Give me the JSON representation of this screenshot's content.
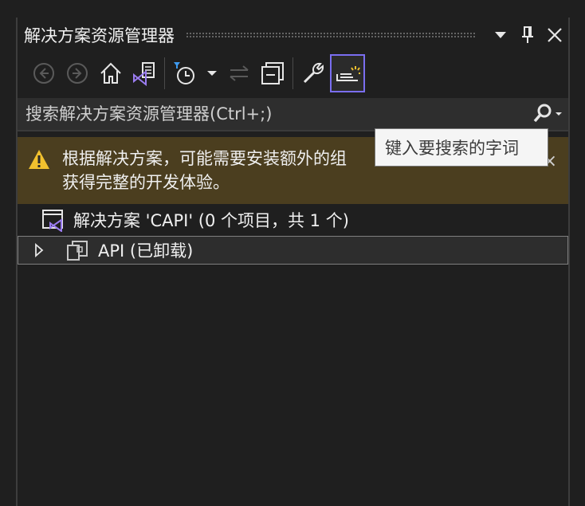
{
  "window": {
    "title": "解决方案资源管理器"
  },
  "search": {
    "placeholder": "搜索解决方案资源管理器(Ctrl+;)"
  },
  "infobar": {
    "line1": "根据解决方案，可能需要安装额外的组",
    "line2": "获得完整的开发体验。",
    "close_glyph": "×"
  },
  "tree": {
    "root_label": "解决方案 'CAPI' (0 个项目，共 1 个)",
    "project_label": "API (已卸载)"
  },
  "tooltip": {
    "text": "键入要搜索的字词"
  },
  "icons": {
    "dropdown": "chevron-down-icon",
    "pin": "pin-icon",
    "close": "close-icon",
    "back": "back-icon",
    "forward": "forward-icon",
    "home": "home-icon",
    "switch_views": "vs-switch-views-icon",
    "pending_changes": "history-filter-icon",
    "sync": "sync-with-active-document-icon",
    "collapse_all": "collapse-all-icon",
    "properties": "wrench-icon",
    "preview": "preview-selected-items-icon",
    "search": "search-icon",
    "warning": "warning-icon",
    "solution": "solution-icon",
    "project": "project-icon",
    "expand": "expand-arrow-icon"
  },
  "colors": {
    "accent": "#7160e8",
    "background": "#1f1f1f",
    "infobar": "#4b3e1f",
    "warning": "#f2c12e",
    "vs_purple": "#9a7cf0"
  }
}
